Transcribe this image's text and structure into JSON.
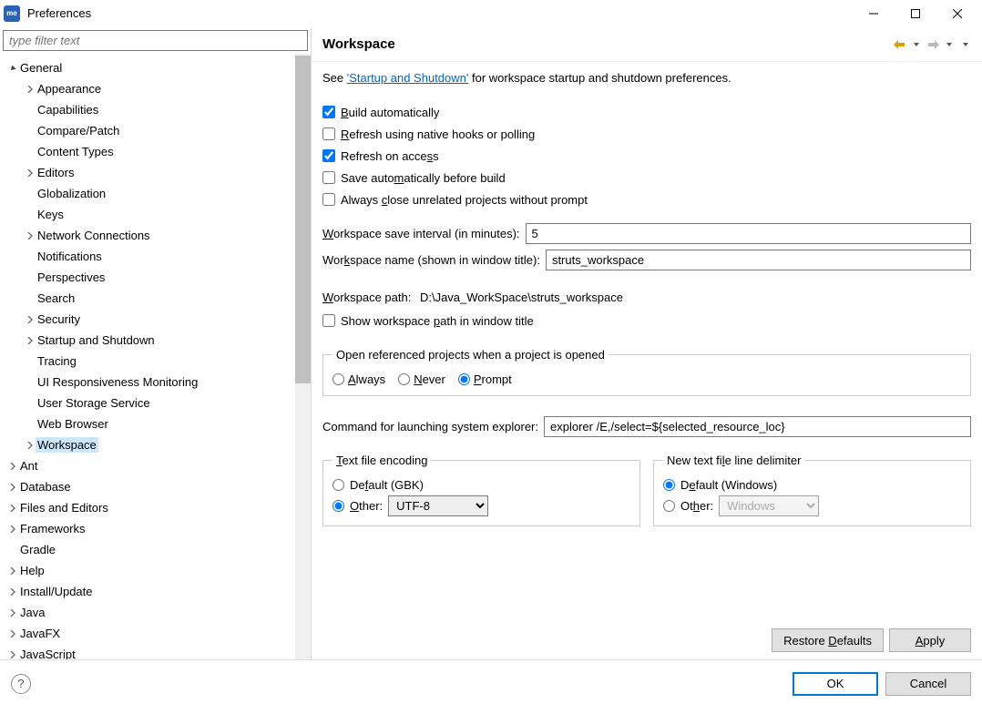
{
  "window": {
    "app_icon_text": "me",
    "title": "Preferences"
  },
  "sidebar": {
    "filter_placeholder": "type filter text",
    "tree": [
      {
        "label": "General",
        "level": 0,
        "expandable": true,
        "expanded": true
      },
      {
        "label": "Appearance",
        "level": 1,
        "expandable": true
      },
      {
        "label": "Capabilities",
        "level": 1,
        "expandable": false
      },
      {
        "label": "Compare/Patch",
        "level": 1,
        "expandable": false
      },
      {
        "label": "Content Types",
        "level": 1,
        "expandable": false
      },
      {
        "label": "Editors",
        "level": 1,
        "expandable": true
      },
      {
        "label": "Globalization",
        "level": 1,
        "expandable": false
      },
      {
        "label": "Keys",
        "level": 1,
        "expandable": false
      },
      {
        "label": "Network Connections",
        "level": 1,
        "expandable": true
      },
      {
        "label": "Notifications",
        "level": 1,
        "expandable": false
      },
      {
        "label": "Perspectives",
        "level": 1,
        "expandable": false
      },
      {
        "label": "Search",
        "level": 1,
        "expandable": false
      },
      {
        "label": "Security",
        "level": 1,
        "expandable": true
      },
      {
        "label": "Startup and Shutdown",
        "level": 1,
        "expandable": true
      },
      {
        "label": "Tracing",
        "level": 1,
        "expandable": false
      },
      {
        "label": "UI Responsiveness Monitoring",
        "level": 1,
        "expandable": false
      },
      {
        "label": "User Storage Service",
        "level": 1,
        "expandable": false
      },
      {
        "label": "Web Browser",
        "level": 1,
        "expandable": false
      },
      {
        "label": "Workspace",
        "level": 1,
        "expandable": true,
        "selected": true
      },
      {
        "label": "Ant",
        "level": 0,
        "expandable": true
      },
      {
        "label": "Database",
        "level": 0,
        "expandable": true
      },
      {
        "label": "Files and Editors",
        "level": 0,
        "expandable": true
      },
      {
        "label": "Frameworks",
        "level": 0,
        "expandable": true
      },
      {
        "label": "Gradle",
        "level": 0,
        "expandable": false
      },
      {
        "label": "Help",
        "level": 0,
        "expandable": true
      },
      {
        "label": "Install/Update",
        "level": 0,
        "expandable": true
      },
      {
        "label": "Java",
        "level": 0,
        "expandable": true
      },
      {
        "label": "JavaFX",
        "level": 0,
        "expandable": true
      },
      {
        "label": "JavaScript",
        "level": 0,
        "expandable": true
      }
    ]
  },
  "content": {
    "title": "Workspace",
    "intro_prefix": "See ",
    "intro_link": "'Startup and Shutdown'",
    "intro_suffix": " for workspace startup and shutdown preferences.",
    "checks": {
      "build_auto": "Build automatically",
      "refresh_native": "Refresh using native hooks or polling",
      "refresh_access": "Refresh on access",
      "save_before_build": "Save automatically before build",
      "close_unrelated": "Always close unrelated projects without prompt"
    },
    "save_interval_label": "Workspace save interval (in minutes):",
    "save_interval_value": "5",
    "ws_name_label": "Workspace name (shown in window title):",
    "ws_name_value": "struts_workspace",
    "ws_path_label": "Workspace path:",
    "ws_path_value": "D:\\Java_WorkSpace\\struts_workspace",
    "show_path_label": "Show workspace path in window title",
    "open_ref_legend": "Open referenced projects when a project is opened",
    "open_ref_options": {
      "always": "Always",
      "never": "Never",
      "prompt": "Prompt"
    },
    "explorer_label": "Command for launching system explorer:",
    "explorer_value": "explorer /E,/select=${selected_resource_loc}",
    "encoding": {
      "legend": "Text file encoding",
      "default_label": "Default (GBK)",
      "other_label": "Other:",
      "other_value": "UTF-8"
    },
    "delimiter": {
      "legend": "New text file line delimiter",
      "default_label": "Default (Windows)",
      "other_label": "Other:",
      "other_value": "Windows"
    },
    "restore_defaults": "Restore Defaults",
    "apply": "Apply"
  },
  "footer": {
    "ok": "OK",
    "cancel": "Cancel"
  }
}
